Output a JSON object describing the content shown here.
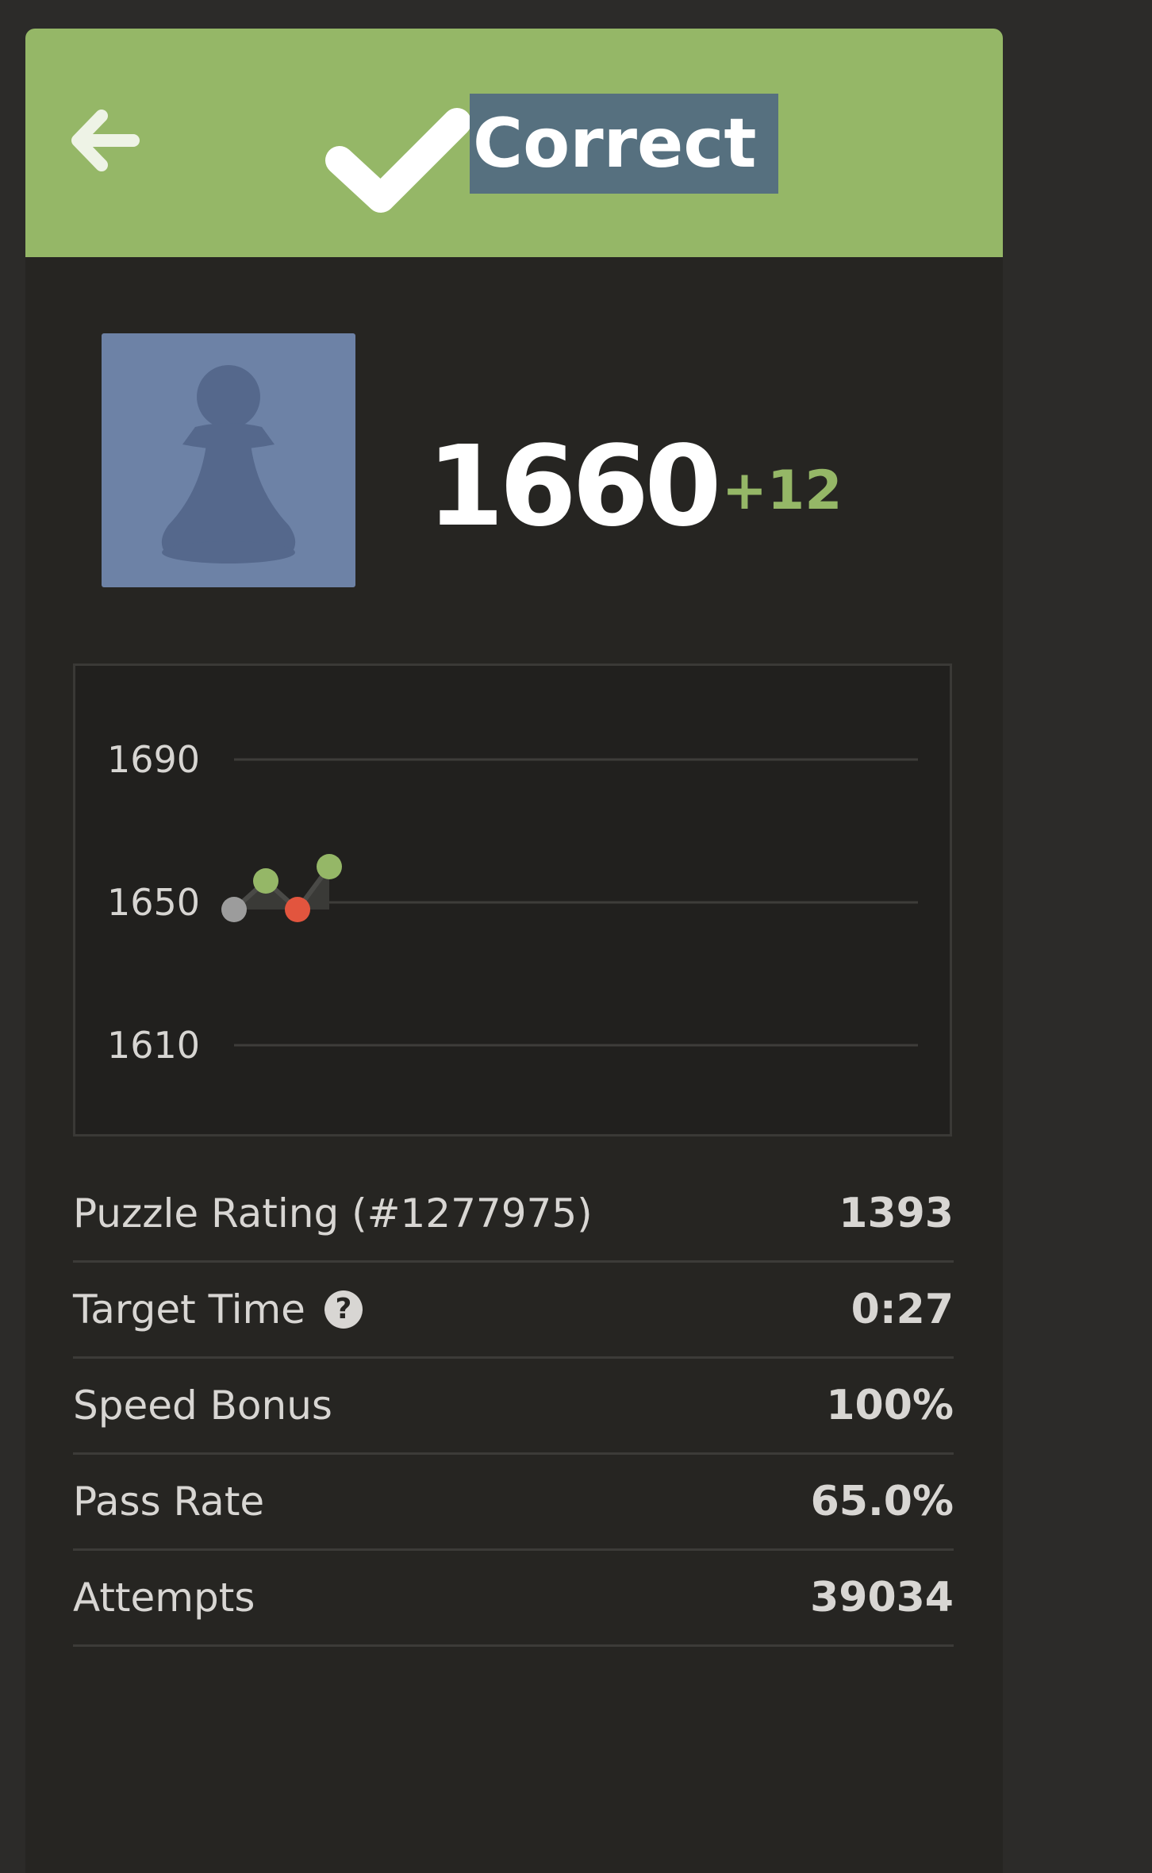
{
  "header": {
    "status": "Correct",
    "back_icon": "arrow-left-icon",
    "check_icon": "checkmark-icon",
    "background": "#95b767",
    "highlight": "#56707f"
  },
  "user": {
    "avatar_icon": "pawn-icon",
    "rating": "1660",
    "rating_change": "+12"
  },
  "chart_data": {
    "type": "line",
    "ylim": [
      1610,
      1690
    ],
    "yticks": [
      "1690",
      "1650",
      "1610"
    ],
    "grid": true,
    "x": [
      1,
      2,
      3,
      4
    ],
    "values": [
      1648,
      1656,
      1648,
      1660
    ],
    "point_colors": [
      "#9c9c9c",
      "#95b767",
      "#e2553e",
      "#95b767"
    ],
    "line_color": "#4a4a47"
  },
  "stats": [
    {
      "label": "Puzzle Rating (#1277975)",
      "value": "1393"
    },
    {
      "label": "Target Time",
      "value": "0:27"
    },
    {
      "label": "Speed Bonus",
      "value": "100%"
    },
    {
      "label": "Pass Rate",
      "value": "65.0%"
    },
    {
      "label": "Attempts",
      "value": "39034"
    }
  ]
}
